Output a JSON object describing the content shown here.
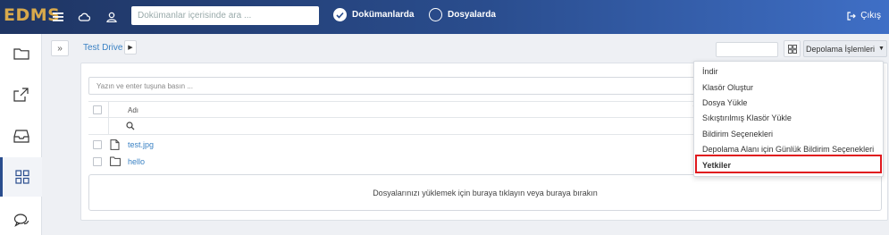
{
  "app": {
    "logo": "EDMS"
  },
  "header": {
    "search_placeholder": "Dokümanlar içerisinde ara ...",
    "radio_documents": "Dokümanlarda",
    "radio_files": "Dosyalarda",
    "logout_label": "Çıkış"
  },
  "breadcrumb": {
    "current": "Test Drive"
  },
  "toolbar": {
    "storage_label": "Depolama İşlemleri"
  },
  "filter": {
    "placeholder": "Yazın ve enter tuşuna basın ..."
  },
  "table": {
    "header_name": "Adı",
    "rows": [
      {
        "name": "test.jpg",
        "type": "file"
      },
      {
        "name": "hello",
        "type": "folder"
      }
    ]
  },
  "dropzone": {
    "text": "Dosyalarınızı yüklemek için buraya tıklayın veya buraya bırakın"
  },
  "menu": {
    "items": [
      "İndir",
      "Klasör Oluştur",
      "Dosya Yükle",
      "Sıkıştırılmış Klasör Yükle",
      "Bildirim Seçenekleri",
      "Depolama Alanı için Günlük Bildirim Seçenekleri",
      "Yetkiler"
    ],
    "highlighted": "Yetkiler"
  },
  "colors": {
    "accent": "#3b82c4",
    "header_dark": "#1f3563",
    "highlight": "#e0191e",
    "logo": "#d8a94c"
  }
}
